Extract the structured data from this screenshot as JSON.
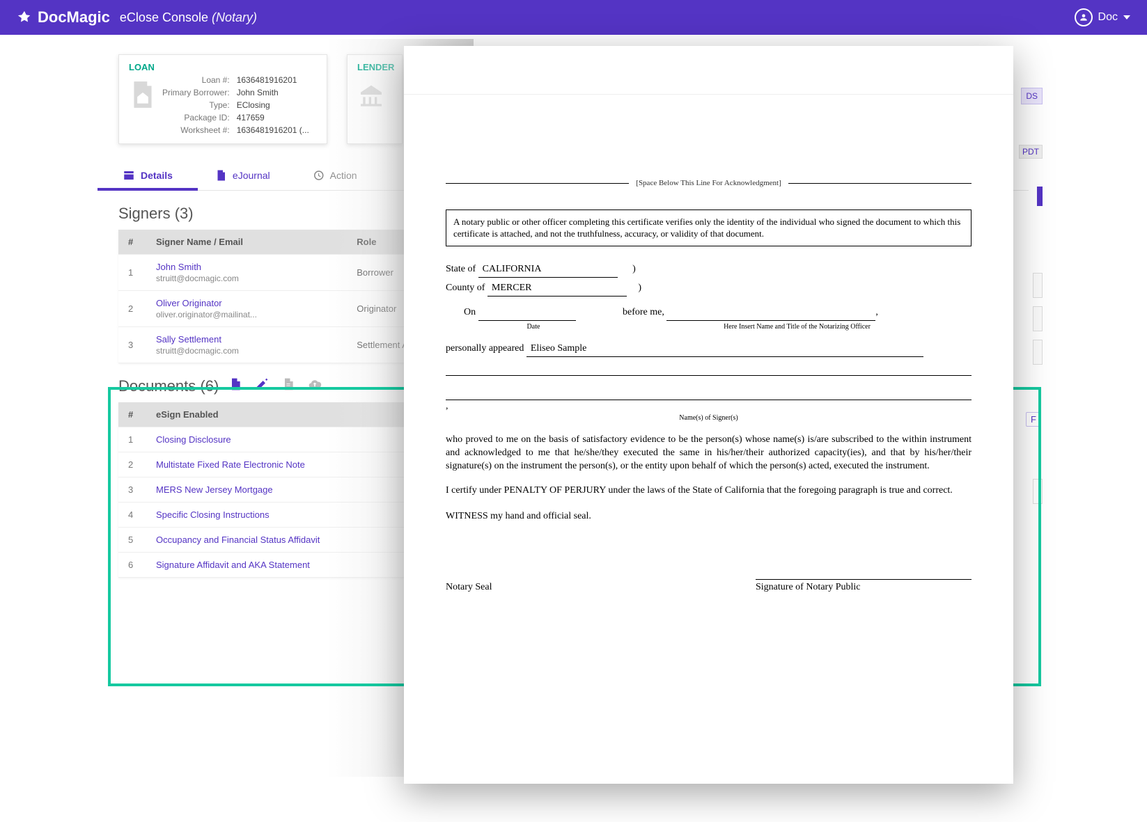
{
  "topbar": {
    "brand": "DocMagic",
    "console": "eClose Console",
    "role": "(Notary)",
    "user_label": "Doc"
  },
  "loan_card": {
    "title": "LOAN",
    "rows": [
      {
        "k": "Loan #:",
        "v": "1636481916201"
      },
      {
        "k": "Primary Borrower:",
        "v": "John Smith"
      },
      {
        "k": "Type:",
        "v": "EClosing"
      },
      {
        "k": "Package ID:",
        "v": "417659"
      },
      {
        "k": "Worksheet #:",
        "v": "1636481916201 (..."
      }
    ]
  },
  "lender_card": {
    "title": "LENDER"
  },
  "tabs": {
    "details": "Details",
    "ejournal": "eJournal",
    "action": "Action"
  },
  "signers": {
    "heading": "Signers (3)",
    "cols": {
      "idx": "#",
      "name": "Signer Name / Email",
      "role": "Role"
    },
    "rows": [
      {
        "idx": "1",
        "name": "John Smith",
        "email": "struitt@docmagic.com",
        "role": "Borrower"
      },
      {
        "idx": "2",
        "name": "Oliver Originator",
        "email": "oliver.originator@mailinat...",
        "role": "Originator"
      },
      {
        "idx": "3",
        "name": "Sally Settlement",
        "email": "struitt@docmagic.com",
        "role": "Settlement Agent"
      }
    ]
  },
  "documents": {
    "heading": "Documents (6)",
    "cols": {
      "idx": "#",
      "esign": "eSign Enabled"
    },
    "rows": [
      {
        "idx": "1",
        "name": "Closing Disclosure"
      },
      {
        "idx": "2",
        "name": "Multistate Fixed Rate Electronic Note"
      },
      {
        "idx": "3",
        "name": "MERS New Jersey Mortgage"
      },
      {
        "idx": "4",
        "name": "Specific Closing Instructions"
      },
      {
        "idx": "5",
        "name": "Occupancy and Financial Status Affidavit"
      },
      {
        "idx": "6",
        "name": "Signature Affidavit and AKA Statement"
      }
    ]
  },
  "right_frags": {
    "f1": "DS",
    "f2": "PDT",
    "f4": "F"
  },
  "doc": {
    "sep": "[Space Below This Line For Acknowledgment]",
    "cert": "A notary public or other officer completing this certificate verifies only the identity of the individual who signed the document to which this certificate is attached, and not the truthfulness,  accuracy, or validity of that document.",
    "state_lbl": "State of",
    "state_val": "CALIFORNIA",
    "county_lbl": "County of",
    "county_val": "MERCER",
    "on_lbl": "On",
    "before_lbl": "before me,",
    "date_cap": "Date",
    "officer_cap": "Here Insert Name and Title of the Notarizing Officer",
    "appeared_lbl": "personally appeared",
    "appeared_val": "Eliseo Sample",
    "names_cap": "Name(s) of Signer(s)",
    "body1": "who proved to me on the basis of satisfactory evidence to be the person(s) whose name(s) is/are subscribed to the within instrument and acknowledged to me that he/she/they executed the same in his/her/their authorized capacity(ies), and that by his/her/their signature(s) on the instrument the person(s), or the entity upon behalf of which the person(s) acted, executed the instrument.",
    "body2": "I certify under PENALTY OF PERJURY under the laws of the State of California that the foregoing paragraph is true and correct.",
    "body3": "WITNESS my hand and official seal.",
    "seal": "Notary Seal",
    "sig_cap": "Signature of Notary Public"
  }
}
